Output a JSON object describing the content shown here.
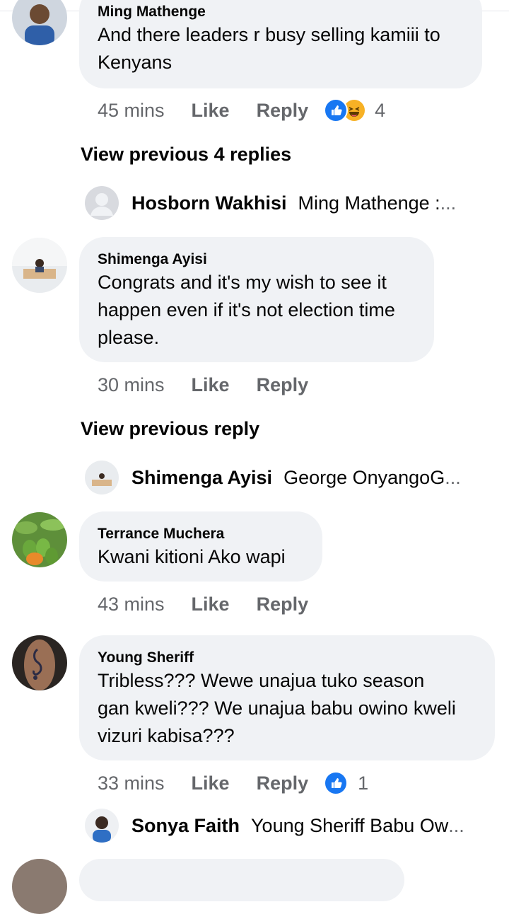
{
  "comments": [
    {
      "author": "Ming Mathenge",
      "lines": [
        "And there leaders r busy selling kamiii to",
        "Kenyans"
      ],
      "time": "45 mins",
      "like": "Like",
      "reply": "Reply",
      "reaction_count": "4",
      "reactions": [
        "like-reaction-icon",
        "haha-reaction-icon"
      ]
    },
    {
      "author": "Shimenga Ayisi",
      "lines": [
        "Congrats and it's my wish to see it",
        "happen even if it's not election time",
        "please."
      ],
      "time": "30 mins",
      "like": "Like",
      "reply": "Reply"
    },
    {
      "author": "Terrance Muchera",
      "lines": [
        "Kwani kitioni Ako wapi"
      ],
      "time": "43 mins",
      "like": "Like",
      "reply": "Reply"
    },
    {
      "author": "Young Sheriff",
      "lines": [
        "Tribless??? Wewe unajua tuko season",
        "gan kweli??? We unajua babu owino kweli",
        "vizuri kabisa???"
      ],
      "time": "33 mins",
      "like": "Like",
      "reply": "Reply",
      "reaction_count": "1",
      "reactions": [
        "like-reaction-icon"
      ]
    }
  ],
  "view_previous": [
    "View previous 4 replies",
    "View previous reply"
  ],
  "reply_previews": [
    {
      "name": "Hosborn Wakhisi",
      "text": "Ming Mathenge : ",
      "ellipsis": "..."
    },
    {
      "name": "Shimenga Ayisi",
      "text": "George OnyangoG",
      "ellipsis": "..."
    },
    {
      "name": "Sonya Faith",
      "text": "Young Sheriff Babu Ow",
      "ellipsis": "..."
    }
  ],
  "colors": {
    "bubble": "#f0f2f5",
    "meta_text": "#65676b",
    "like_blue": "#1877f2",
    "haha_yellow": "#f7b125"
  }
}
